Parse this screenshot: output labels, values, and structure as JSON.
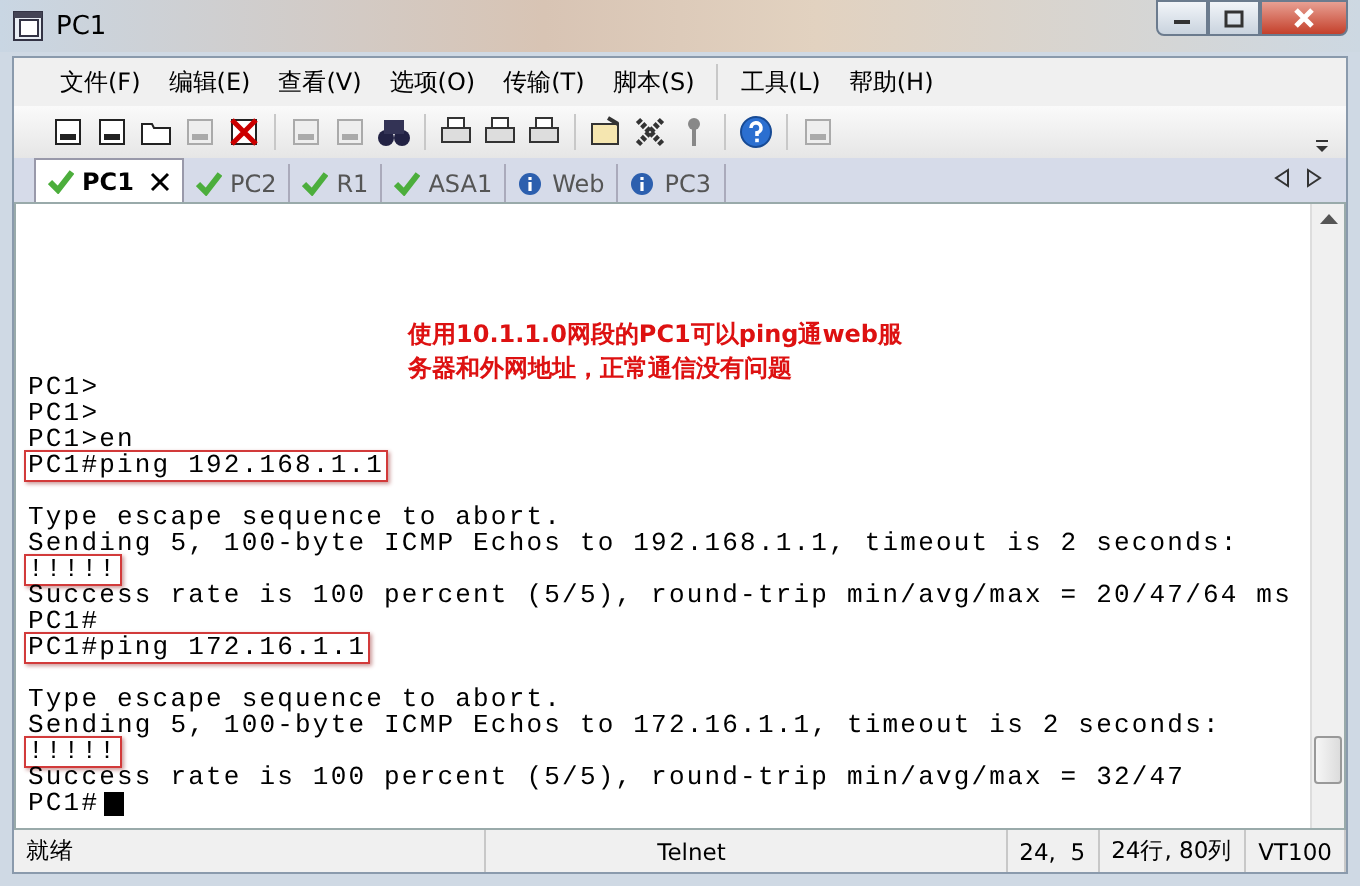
{
  "window": {
    "title": "PC1"
  },
  "menu": [
    "文件(F)",
    "编辑(E)",
    "查看(V)",
    "选项(O)",
    "传输(T)",
    "脚本(S)",
    "工具(L)",
    "帮助(H)"
  ],
  "tabs": [
    {
      "label": "PC1",
      "selected": true,
      "kind": "ok"
    },
    {
      "label": "PC2",
      "selected": false,
      "kind": "ok"
    },
    {
      "label": "R1",
      "selected": false,
      "kind": "ok"
    },
    {
      "label": "ASA1",
      "selected": false,
      "kind": "ok"
    },
    {
      "label": "Web",
      "selected": false,
      "kind": "info"
    },
    {
      "label": "PC3",
      "selected": false,
      "kind": "info"
    }
  ],
  "annotation": [
    "使用10.1.1.0网段的PC1可以ping通web服",
    "务器和外网地址，正常通信没有问题"
  ],
  "terminal": {
    "blocks": [
      [
        {
          "text": "PC1>",
          "highlighted": false
        },
        {
          "text": "PC1>",
          "highlighted": false
        },
        {
          "text": "PC1>en",
          "highlighted": false
        },
        {
          "text": "PC1#ping 192.168.1.1",
          "highlighted": true
        }
      ],
      [
        {
          "text": "Type escape sequence to abort.",
          "highlighted": false
        },
        {
          "text": "Sending 5, 100-byte ICMP Echos to 192.168.1.1, timeout is 2 seconds:",
          "highlighted": false
        },
        {
          "text": "!!!!!",
          "highlighted": true
        },
        {
          "text": "Success rate is 100 percent (5/5), round-trip min/avg/max = 20/47/64 ms",
          "highlighted": false
        },
        {
          "text": "PC1#",
          "highlighted": false
        },
        {
          "text": "PC1#ping 172.16.1.1",
          "highlighted": true
        }
      ],
      [
        {
          "text": "Type escape sequence to abort.",
          "highlighted": false
        },
        {
          "text": "Sending 5, 100-byte ICMP Echos to 172.16.1.1, timeout is 2 seconds:",
          "highlighted": false
        },
        {
          "text": "!!!!!",
          "highlighted": true
        },
        {
          "text": "Success rate is 100 percent (5/5), round-trip min/avg/max = 32/47",
          "highlighted": false
        },
        {
          "text": "PC1#",
          "highlighted": false,
          "cursor": true
        }
      ]
    ]
  },
  "status_bar": [
    "就绪",
    "Telnet",
    "24,  5",
    "24行, 80列",
    "VT100"
  ]
}
